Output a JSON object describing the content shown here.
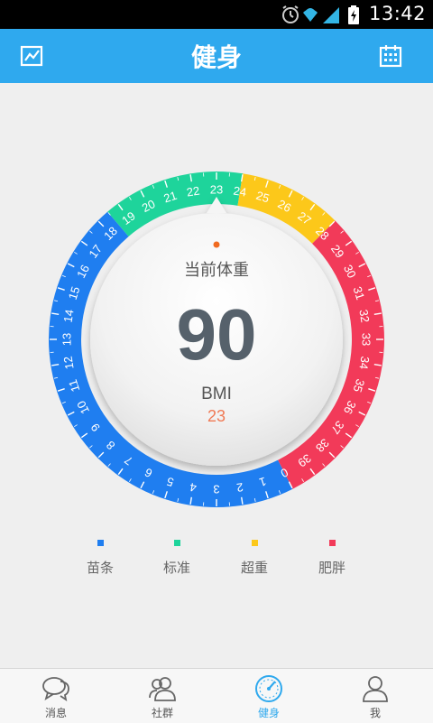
{
  "status_bar": {
    "time": "13:42",
    "icons": [
      "alarm-icon",
      "wifi-icon",
      "signal-icon",
      "battery-icon"
    ]
  },
  "header": {
    "title": "健身",
    "left_icon": "trend-chart-icon",
    "right_icon": "calendar-icon"
  },
  "dial": {
    "label": "当前体重",
    "weight": "90",
    "bmi_label": "BMI",
    "bmi_value": "23",
    "scale_min": 0,
    "scale_max": 39,
    "pointer_value": 23,
    "segments": [
      {
        "name": "苗条",
        "from": 0,
        "to": 18.5,
        "color": "#1f7ef0"
      },
      {
        "name": "标准",
        "from": 18.5,
        "to": 24,
        "color": "#1ed49b"
      },
      {
        "name": "超重",
        "from": 24,
        "to": 28,
        "color": "#fcc81a"
      },
      {
        "name": "肥胖",
        "from": 28,
        "to": 40,
        "color": "#f23a59"
      }
    ]
  },
  "legend": [
    {
      "label": "苗条",
      "color": "#1f7ef0"
    },
    {
      "label": "标准",
      "color": "#1ed49b"
    },
    {
      "label": "超重",
      "color": "#fcc81a"
    },
    {
      "label": "肥胖",
      "color": "#f23a59"
    }
  ],
  "tabs": [
    {
      "label": "消息",
      "icon": "message-icon",
      "active": false
    },
    {
      "label": "社群",
      "icon": "community-icon",
      "active": false
    },
    {
      "label": "健身",
      "icon": "fitness-gauge-icon",
      "active": true
    },
    {
      "label": "我",
      "icon": "profile-icon",
      "active": false
    }
  ],
  "colors": {
    "accent": "#2fa9ee",
    "weight_text": "#56616b",
    "bmi_value": "#f07a55",
    "pointer_dot": "#f06a20"
  }
}
